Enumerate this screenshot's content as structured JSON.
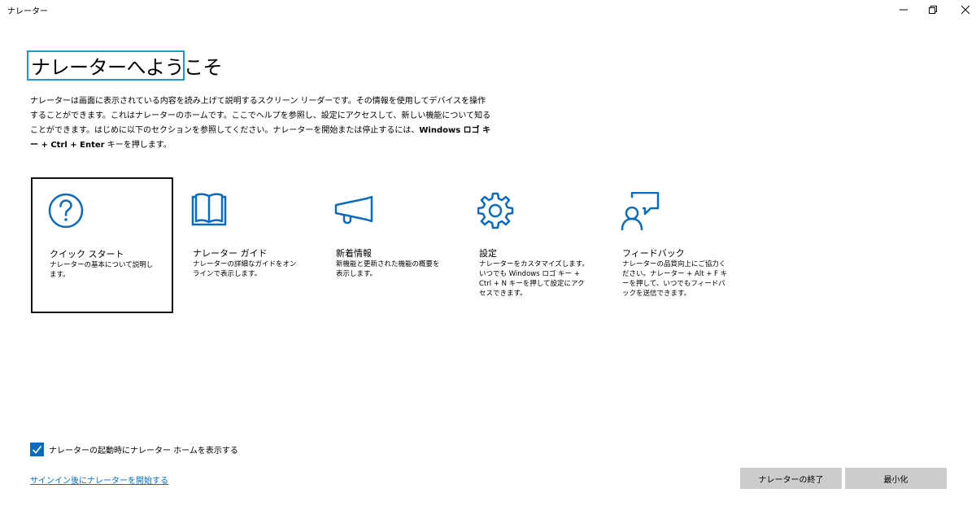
{
  "window": {
    "title": "ナレーター"
  },
  "heading": "ナレーターへようこそ",
  "intro": {
    "text_before_bold": "ナレーターは画面に表示されている内容を読み上げて説明するスクリーン リーダーです。その情報を使用してデバイスを操作することができます。これはナレーターのホームです。ここでヘルプを参照し、設定にアクセスして、新しい機能について知ることができます。はじめに以下のセクションを参照してください。ナレーターを開始または停止するには、",
    "bold": "Windows ロゴ キー + Ctrl + Enter",
    "text_after_bold": " キーを押します。"
  },
  "cards": [
    {
      "id": "quickstart",
      "icon": "question-circle-icon",
      "title": "クイック スタート",
      "description": "ナレーターの基本について説明します。"
    },
    {
      "id": "guide",
      "icon": "book-icon",
      "title": "ナレーター ガイド",
      "description": "ナレーターの詳細なガイドをオンラインで表示します。"
    },
    {
      "id": "whatsnew",
      "icon": "megaphone-icon",
      "title": "新着情報",
      "description": "新機能と更新された機能の概要を表示します。"
    },
    {
      "id": "settings",
      "icon": "gear-icon",
      "title": "設定",
      "description": "ナレーターをカスタマイズします。いつでも Windows ロゴ キー + Ctrl + N キーを押して設定にアクセスできます。"
    },
    {
      "id": "feedback",
      "icon": "person-feedback-icon",
      "title": "フィードバック",
      "description": "ナレーターの品質向上にご協力ください。ナレーター + Alt + F キーを押して、いつでもフィードバックを送信できます。"
    }
  ],
  "show_home_checkbox": {
    "label": "ナレーターの起動時にナレーター ホームを表示する",
    "checked": true
  },
  "signin_link": "サインイン後にナレーターを開始する",
  "buttons": {
    "exit": "ナレーターの終了",
    "minimize": "最小化"
  },
  "colors": {
    "accent": "#0b6cbd",
    "focus_outline": "#1a9ad6",
    "button_bg": "#cccccc"
  }
}
